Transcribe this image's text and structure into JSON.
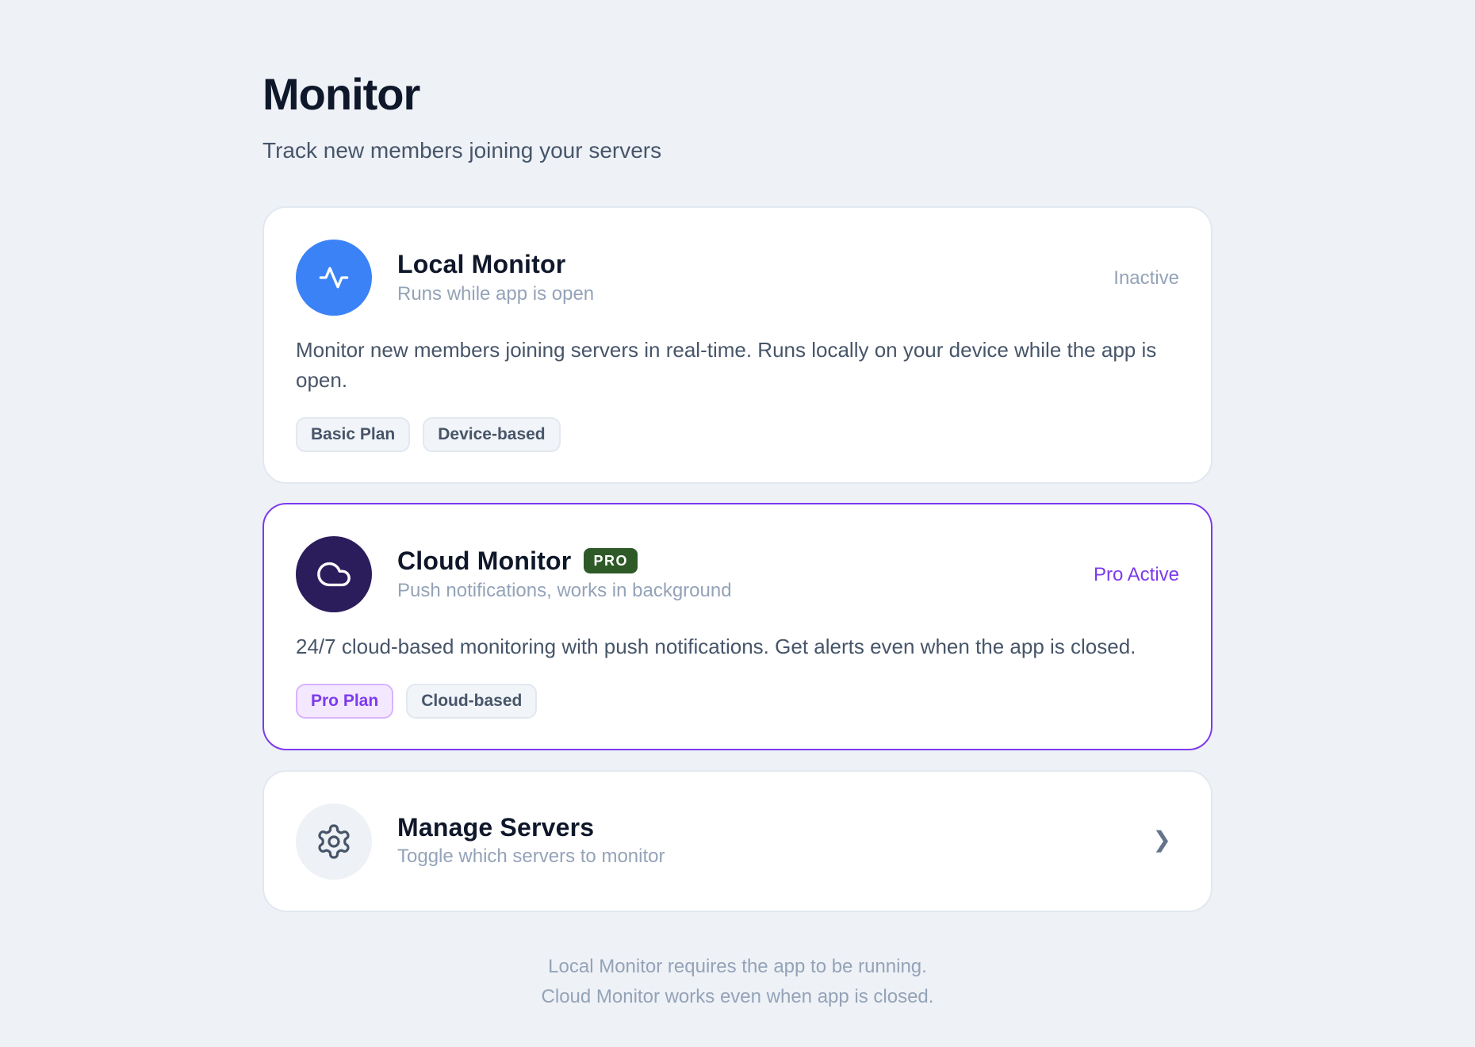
{
  "header": {
    "title": "Monitor",
    "subtitle": "Track new members joining your servers"
  },
  "local_monitor": {
    "icon": "activity-icon",
    "title": "Local Monitor",
    "subtitle": "Runs while app is open",
    "status": "Inactive",
    "description": "Monitor new members joining servers in real-time. Runs locally on your device while the app is open.",
    "tags": [
      "Basic Plan",
      "Device-based"
    ],
    "accent_color": "#3b82f6"
  },
  "cloud_monitor": {
    "icon": "cloud-icon",
    "title": "Cloud Monitor",
    "badge": "PRO",
    "subtitle": "Push notifications, works in background",
    "status": "Pro Active",
    "description": "24/7 cloud-based monitoring with push notifications. Get alerts even when the app is closed.",
    "tags": [
      "Pro Plan",
      "Cloud-based"
    ],
    "accent_color": "#7c3aed",
    "badge_color": "#2d5a27"
  },
  "manage_servers": {
    "icon": "gear-icon",
    "title": "Manage Servers",
    "subtitle": "Toggle which servers to monitor",
    "chevron": "❯"
  },
  "footer": {
    "line1": "Local Monitor requires the app to be running.",
    "line2": "Cloud Monitor works even when app is closed."
  }
}
